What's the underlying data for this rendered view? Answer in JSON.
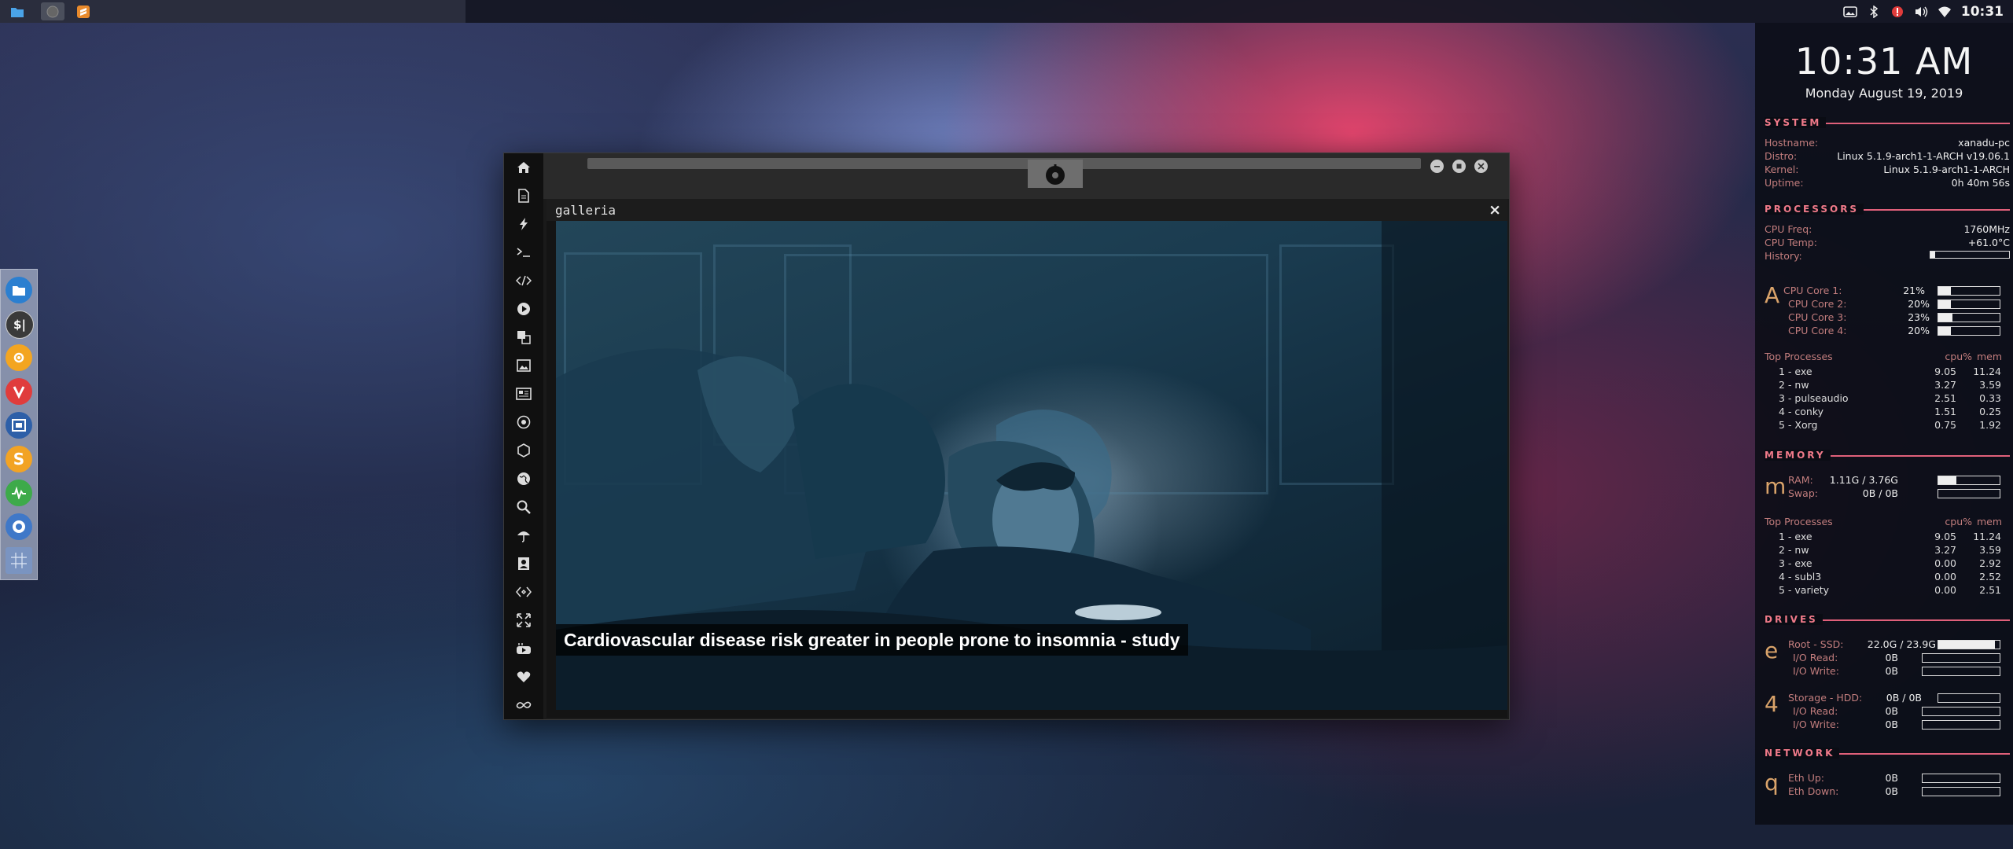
{
  "window": {
    "gallery_title": "galleria",
    "close_label": "×",
    "headline": "Cardiovascular disease risk greater in people prone to insomnia - study"
  },
  "topbar": {
    "time": "10:31"
  },
  "conky": {
    "time": "10:31 AM",
    "date": "Monday August 19, 2019",
    "system": {
      "title": "SYSTEM",
      "hostname_k": "Hostname:",
      "hostname_v": "xanadu-pc",
      "distro_k": "Distro:",
      "distro_v": "Linux 5.1.9-arch1-1-ARCH v19.06.1",
      "kernel_k": "Kernel:",
      "kernel_v": "Linux 5.1.9-arch1-1-ARCH",
      "uptime_k": "Uptime:",
      "uptime_v": "0h 40m 56s"
    },
    "processors": {
      "title": "PROCESSORS",
      "freq_k": "CPU Freq:",
      "freq_v": "1760MHz",
      "temp_k": "CPU Temp:",
      "temp_v": "+61.0°C",
      "history_k": "History:",
      "glyph": "A",
      "cores": [
        {
          "label": "CPU Core 1:",
          "value": "21%",
          "pct": 21
        },
        {
          "label": "CPU Core 2:",
          "value": "20%",
          "pct": 20
        },
        {
          "label": "CPU Core 3:",
          "value": "23%",
          "pct": 23
        },
        {
          "label": "CPU Core 4:",
          "value": "20%",
          "pct": 20
        }
      ],
      "top_label": "Top Processes",
      "cpu_label": "cpu%",
      "mem_label": "mem",
      "top": [
        {
          "name": "1  -  exe",
          "cpu": "9.05",
          "mem": "11.24"
        },
        {
          "name": "2  -  nw",
          "cpu": "3.27",
          "mem": "3.59"
        },
        {
          "name": "3  -  pulseaudio",
          "cpu": "2.51",
          "mem": "0.33"
        },
        {
          "name": "4  -  conky",
          "cpu": "1.51",
          "mem": "0.25"
        },
        {
          "name": "5  -  Xorg",
          "cpu": "0.75",
          "mem": "1.92"
        }
      ]
    },
    "memory": {
      "title": "MEMORY",
      "glyph": "m",
      "ram_k": "RAM:",
      "ram_v": "1.11G / 3.76G",
      "ram_pct": 30,
      "swap_k": "Swap:",
      "swap_v": "0B / 0B",
      "swap_pct": 0,
      "top_label": "Top Processes",
      "cpu_label": "cpu%",
      "mem_label": "mem",
      "top": [
        {
          "name": "1  -  exe",
          "cpu": "9.05",
          "mem": "11.24"
        },
        {
          "name": "2  -  nw",
          "cpu": "3.27",
          "mem": "3.59"
        },
        {
          "name": "3  -  exe",
          "cpu": "0.00",
          "mem": "2.92"
        },
        {
          "name": "4  -  subl3",
          "cpu": "0.00",
          "mem": "2.52"
        },
        {
          "name": "5  -  variety",
          "cpu": "0.00",
          "mem": "2.51"
        }
      ]
    },
    "drives": {
      "title": "DRIVES",
      "root_glyph": "e",
      "root_k": "Root  -  SSD:",
      "root_v": "22.0G / 23.9G",
      "root_pct": 92,
      "root_read_k": "I/O Read:",
      "root_read_v": "0B",
      "root_write_k": "I/O Write:",
      "root_write_v": "0B",
      "storage_glyph": "4",
      "storage_k": "Storage  -  HDD:",
      "storage_v": "0B / 0B",
      "storage_pct": 0,
      "storage_read_k": "I/O Read:",
      "storage_read_v": "0B",
      "storage_write_k": "I/O Write:",
      "storage_write_v": "0B"
    },
    "network": {
      "title": "NETWORK",
      "glyph": "q",
      "up_k": "Eth Up:",
      "up_v": "0B",
      "down_k": "Eth Down:",
      "down_v": "0B"
    }
  },
  "icons": {
    "accent": "#e0607a",
    "label_color": "#c27d7d",
    "glyph_color": "#d9a36a"
  }
}
